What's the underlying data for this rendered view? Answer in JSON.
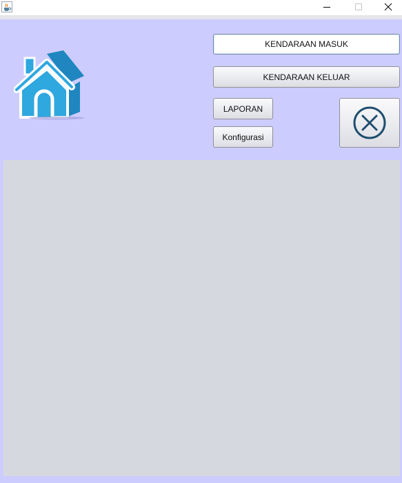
{
  "window": {
    "app_icon": "java-cup-icon",
    "controls": {
      "minimize_icon": "minimize-icon",
      "maximize_icon": "maximize-icon",
      "close_icon": "close-icon"
    }
  },
  "header": {
    "logo_icon": "house-icon",
    "buttons": {
      "masuk_label": "KENDARAAN MASUK",
      "keluar_label": "KENDARAAN KELUAR",
      "laporan_label": "LAPORAN",
      "konfigurasi_label": "Konfigurasi",
      "exit_icon": "circle-x-icon"
    }
  },
  "colors": {
    "background": "#ccccff",
    "panel": "#d6d8e0",
    "logo_blue": "#2fa7df"
  }
}
